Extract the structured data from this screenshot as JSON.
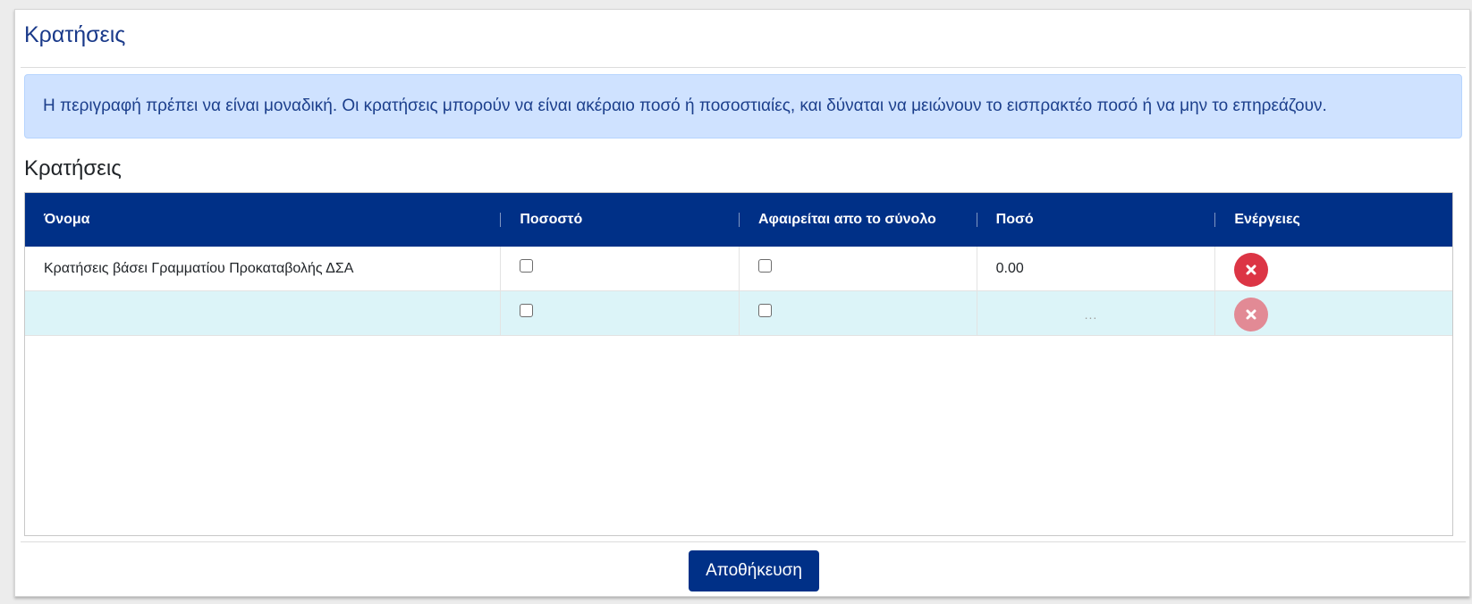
{
  "page": {
    "title": "Κρατήσεις",
    "alert_text": "Η περιγραφή πρέπει να είναι μοναδική. Οι κρατήσεις μπορούν να είναι ακέραιο ποσό ή ποσοστιαίες, και δύναται να μειώνουν το εισπρακτέο ποσό ή να μην το επηρεάζουν.",
    "section_title": "Κρατήσεις"
  },
  "grid": {
    "columns": [
      "Όνομα",
      "Ποσοστό",
      "Αφαιρείται απο το σύνολο",
      "Ποσό",
      "Ενέργειες"
    ],
    "rows": [
      {
        "name": "Κρατήσεις βάσει Γραμματίου Προκαταβολής ΔΣΑ",
        "percentage": false,
        "deducted": false,
        "amount": "0.00",
        "action_icon": "close-icon"
      }
    ],
    "new_row": {
      "name": "",
      "percentage": false,
      "deducted": false,
      "amount_placeholder": "...",
      "action_icon": "close-icon"
    }
  },
  "footer": {
    "save_label": "Αποθήκευση"
  },
  "colors": {
    "primary": "#003087",
    "title": "#1a3a8a",
    "alert_bg": "#cfe2ff",
    "danger": "#dc3545",
    "new_row_bg": "#dcf4f8"
  }
}
